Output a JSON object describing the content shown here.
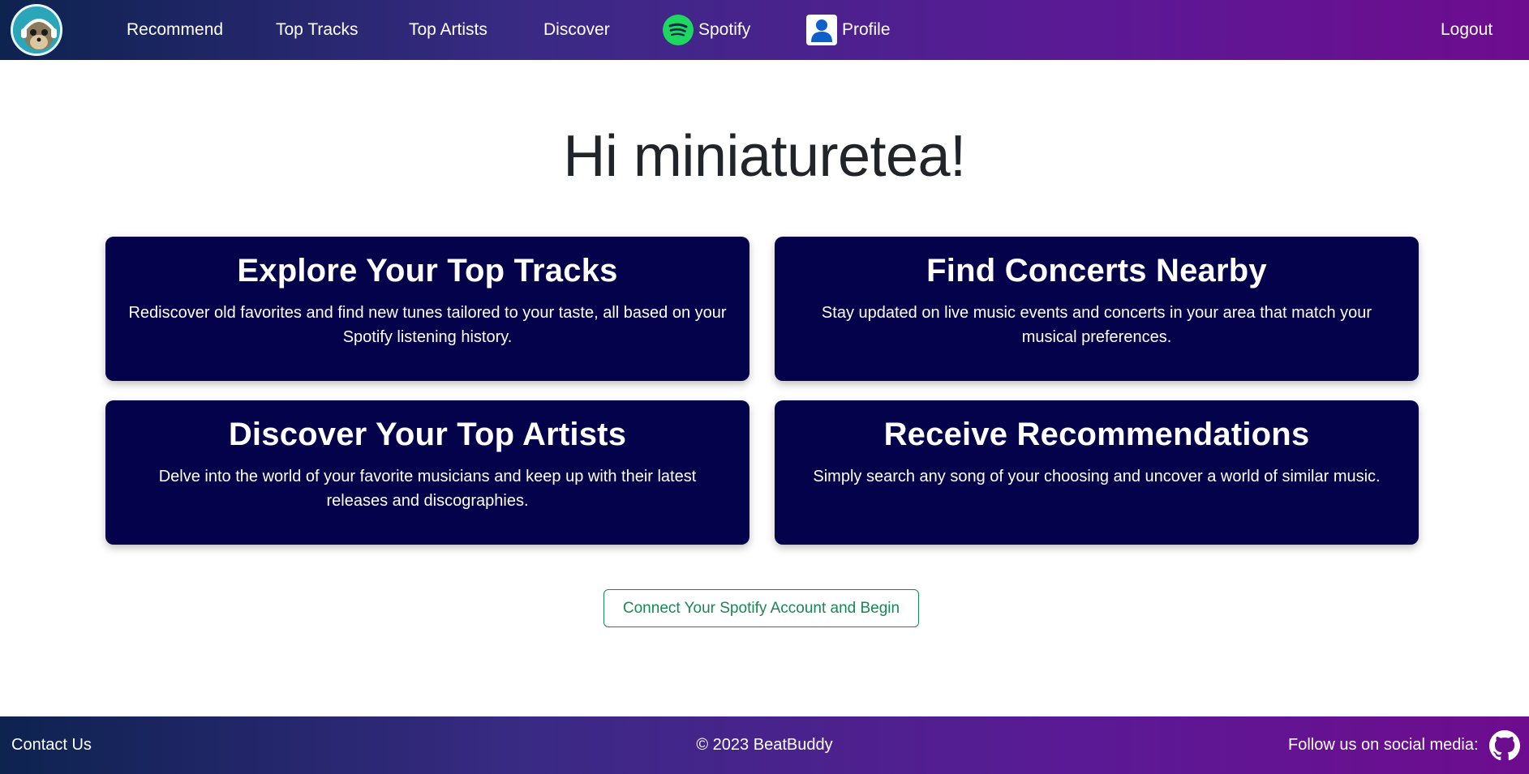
{
  "nav": {
    "links": [
      "Recommend",
      "Top Tracks",
      "Top Artists",
      "Discover"
    ],
    "spotify_label": "Spotify",
    "profile_label": "Profile",
    "logout_label": "Logout"
  },
  "greeting": "Hi miniaturetea!",
  "cards": [
    {
      "title": "Explore Your Top Tracks",
      "text": "Rediscover old favorites and find new tunes tailored to your taste, all based on your Spotify listening history."
    },
    {
      "title": "Find Concerts Nearby",
      "text": "Stay updated on live music events and concerts in your area that match your musical preferences."
    },
    {
      "title": "Discover Your Top Artists",
      "text": "Delve into the world of your favorite musicians and keep up with their latest releases and discographies."
    },
    {
      "title": "Receive Recommendations",
      "text": "Simply search any song of your choosing and uncover a world of similar music."
    }
  ],
  "cta_label": "Connect Your Spotify Account and Begin",
  "footer": {
    "contact": "Contact Us",
    "copyright": "© 2023 BeatBuddy",
    "follow": "Follow us on social media:"
  },
  "colors": {
    "nav_gradient_start": "#0d2350",
    "nav_gradient_end": "#6e0c8f",
    "card_bg": "#03024a",
    "spotify_green": "#1ed760",
    "cta_green": "#198754"
  },
  "icons": {
    "logo": "beatbuddy-logo-icon",
    "spotify": "spotify-icon",
    "profile": "profile-icon",
    "github": "github-icon"
  }
}
